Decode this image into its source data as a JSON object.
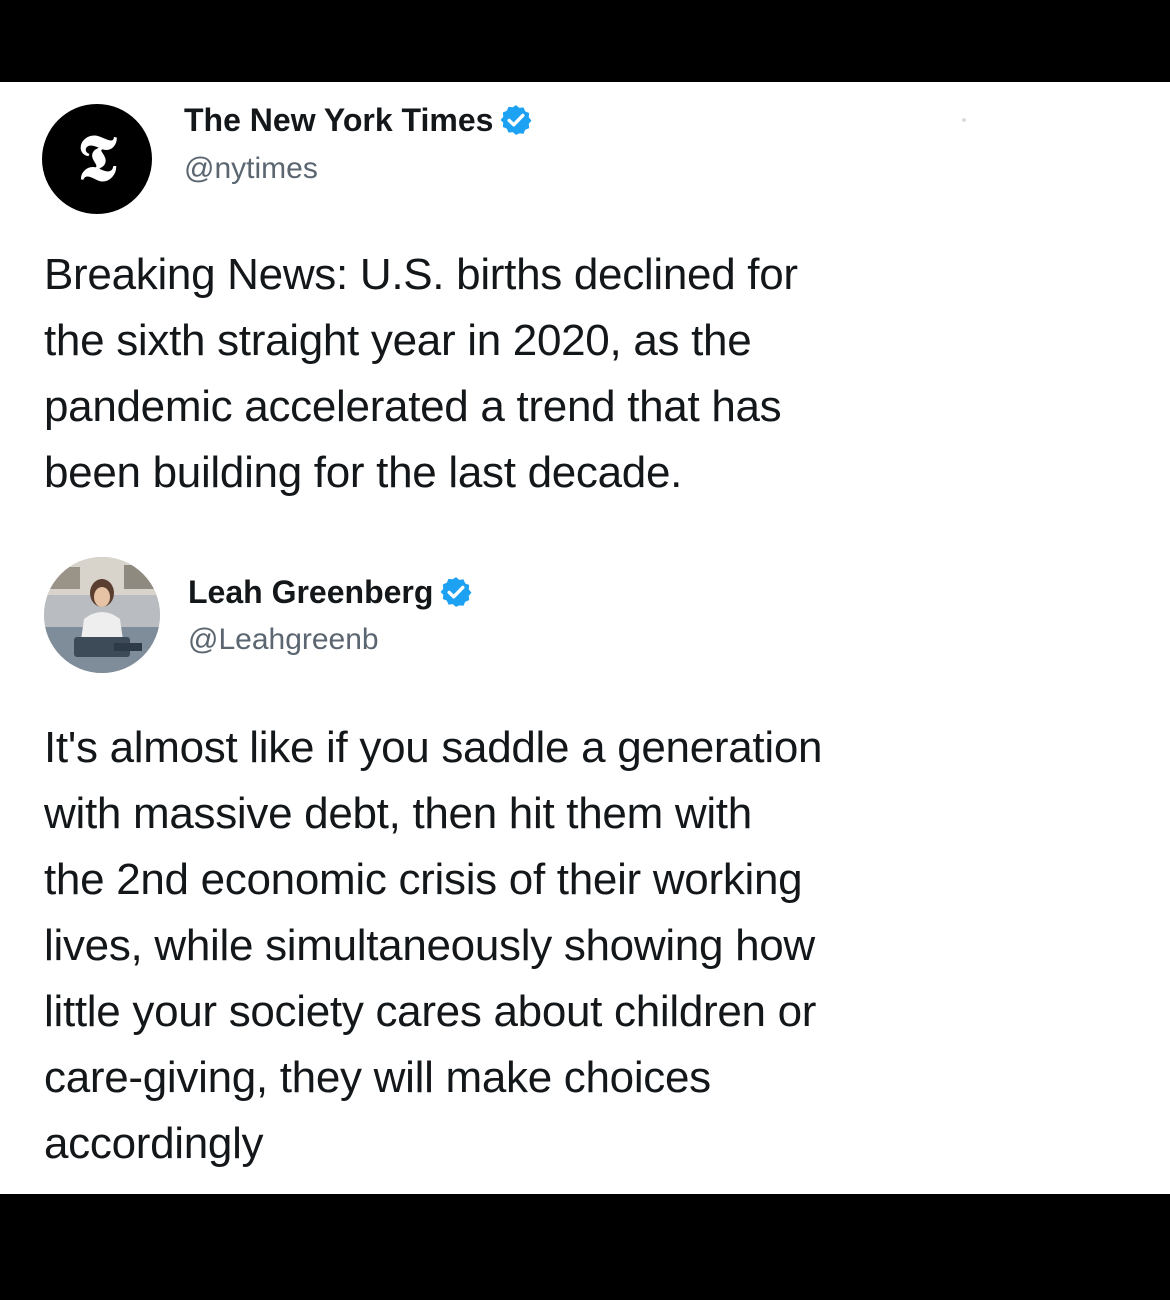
{
  "tweets": [
    {
      "display_name": "The New York Times",
      "handle": "@nytimes",
      "verified": true,
      "avatar_icon": "nyt-logo-icon",
      "avatar_glyph": "𝕿",
      "text": "Breaking News: U.S. births declined for\nthe sixth straight year in 2020, as the\npandemic accelerated a trend that has\nbeen building for the last decade."
    },
    {
      "display_name": "Leah Greenberg",
      "handle": "@Leahgreenb",
      "verified": true,
      "avatar_icon": "profile-photo-icon",
      "text": "It's almost like if you saddle a generation\nwith massive debt, then hit them with\nthe 2nd economic crisis of their working\nlives, while simultaneously showing how\nlittle your society cares about children or\ncare-giving, they will make choices\naccordingly"
    }
  ],
  "colors": {
    "frame": "#000000",
    "card": "#ffffff",
    "text": "#14171a",
    "handle": "#5b6670",
    "verified": "#1da1f2"
  }
}
